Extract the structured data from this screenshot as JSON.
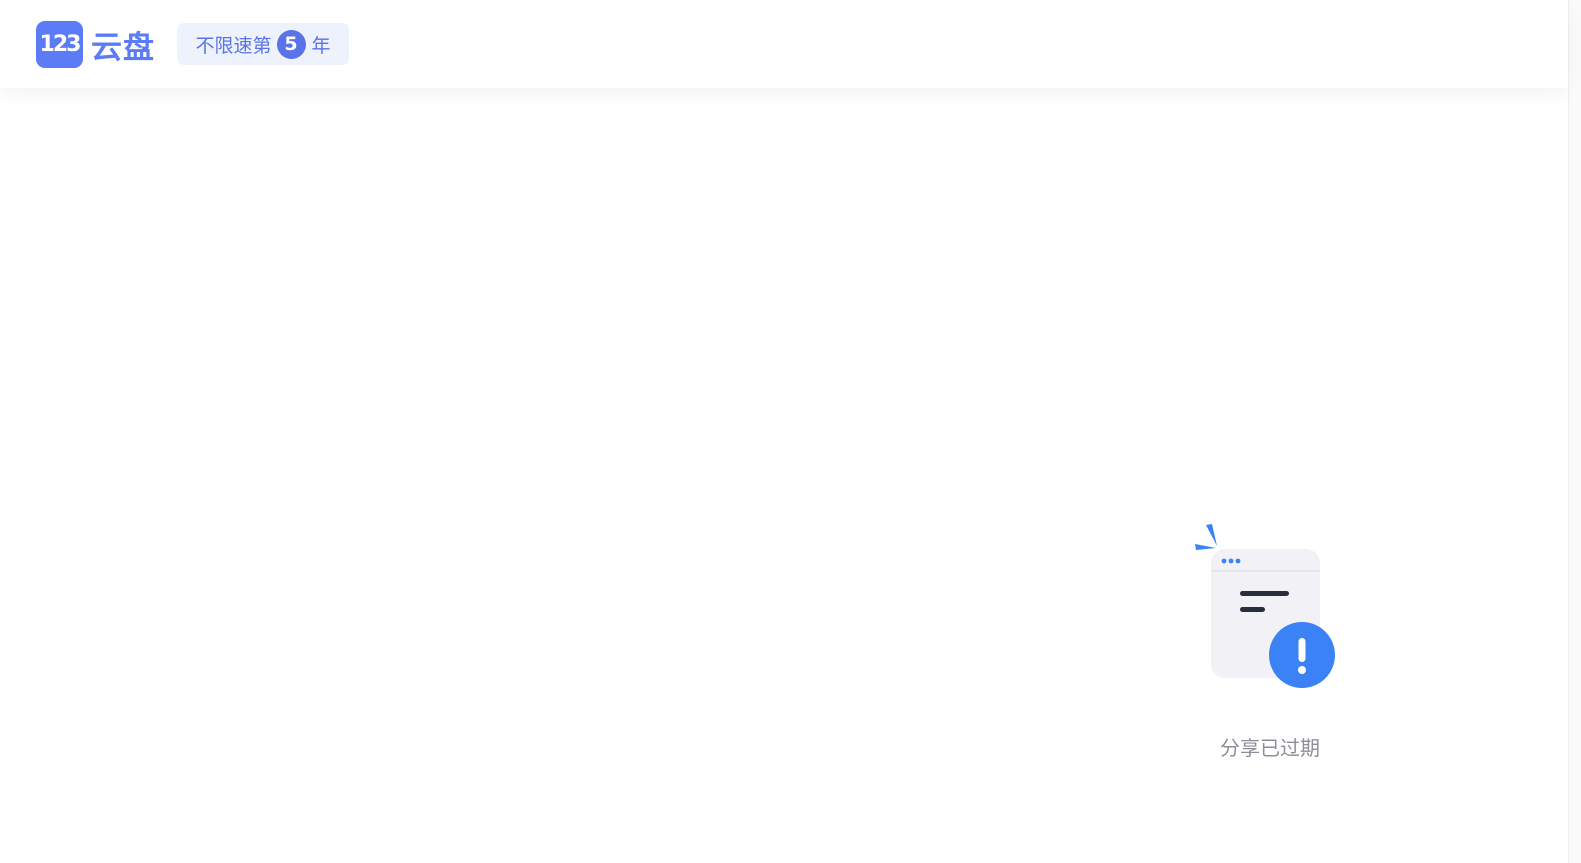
{
  "header": {
    "logo": {
      "mark_text": "123",
      "brand_text": "云盘"
    },
    "badge": {
      "prefix": "不限速第",
      "number": "5",
      "suffix": "年"
    }
  },
  "main": {
    "empty_state": {
      "icon": "expired-share-document-icon",
      "message": "分享已过期"
    }
  },
  "colors": {
    "brand": "#5b7cf6",
    "badge_bg": "#eef2fd",
    "alert_blue": "#3b82f6",
    "message_gray": "#8c8f97"
  }
}
